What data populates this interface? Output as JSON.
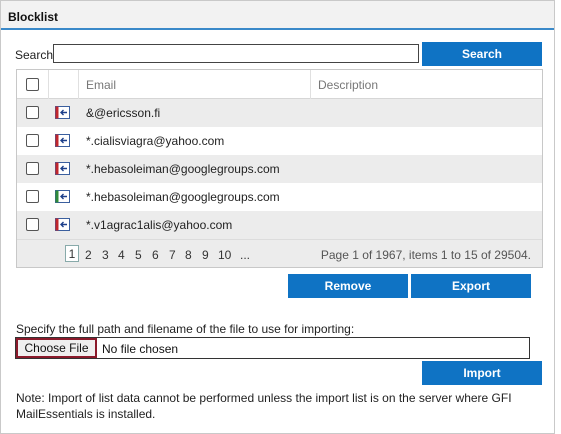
{
  "panel": {
    "title": "Blocklist"
  },
  "search": {
    "label": "Search",
    "value": "",
    "button_label": "Search"
  },
  "grid": {
    "columns": {
      "email": "Email",
      "description": "Description"
    },
    "rows": [
      {
        "email": "&@ericsson.fi",
        "description": "",
        "icon": "import-arrow-icon",
        "icon_color": "#c0262d"
      },
      {
        "email": "*.cialisviagra@yahoo.com",
        "description": "",
        "icon": "import-arrow-icon",
        "icon_color": "#c0262d"
      },
      {
        "email": "*.hebasoleiman@googlegroups.com",
        "description": "",
        "icon": "import-arrow-icon",
        "icon_color": "#c0262d"
      },
      {
        "email": "*.hebasoleiman@googlegroups.com",
        "description": "",
        "icon": "import-arrow-icon",
        "icon_color": "#2f8a3a"
      },
      {
        "email": "*.v1agrac1alis@yahoo.com",
        "description": "",
        "icon": "import-arrow-icon",
        "icon_color": "#c0262d"
      }
    ]
  },
  "pager": {
    "pages": [
      "1",
      "2",
      "3",
      "4",
      "5",
      "6",
      "7",
      "8",
      "9",
      "10",
      "..."
    ],
    "current": "1",
    "info": "Page 1 of 1967, items 1 to 15 of 29504."
  },
  "actions": {
    "remove_label": "Remove",
    "export_label": "Export"
  },
  "import": {
    "label": "Specify the full path and filename of the file to use for importing:",
    "choose_file_label": "Choose File",
    "no_file_text": "No file chosen",
    "button_label": "Import",
    "note": "Note: Import of list data cannot be performed unless the import list is on the server where GFI MailEssentials is installed."
  },
  "colors": {
    "accent": "#0f73c4",
    "header_underline": "#3a89c9",
    "row_alt": "#ececec",
    "focus_border": "#8b1a2b"
  }
}
